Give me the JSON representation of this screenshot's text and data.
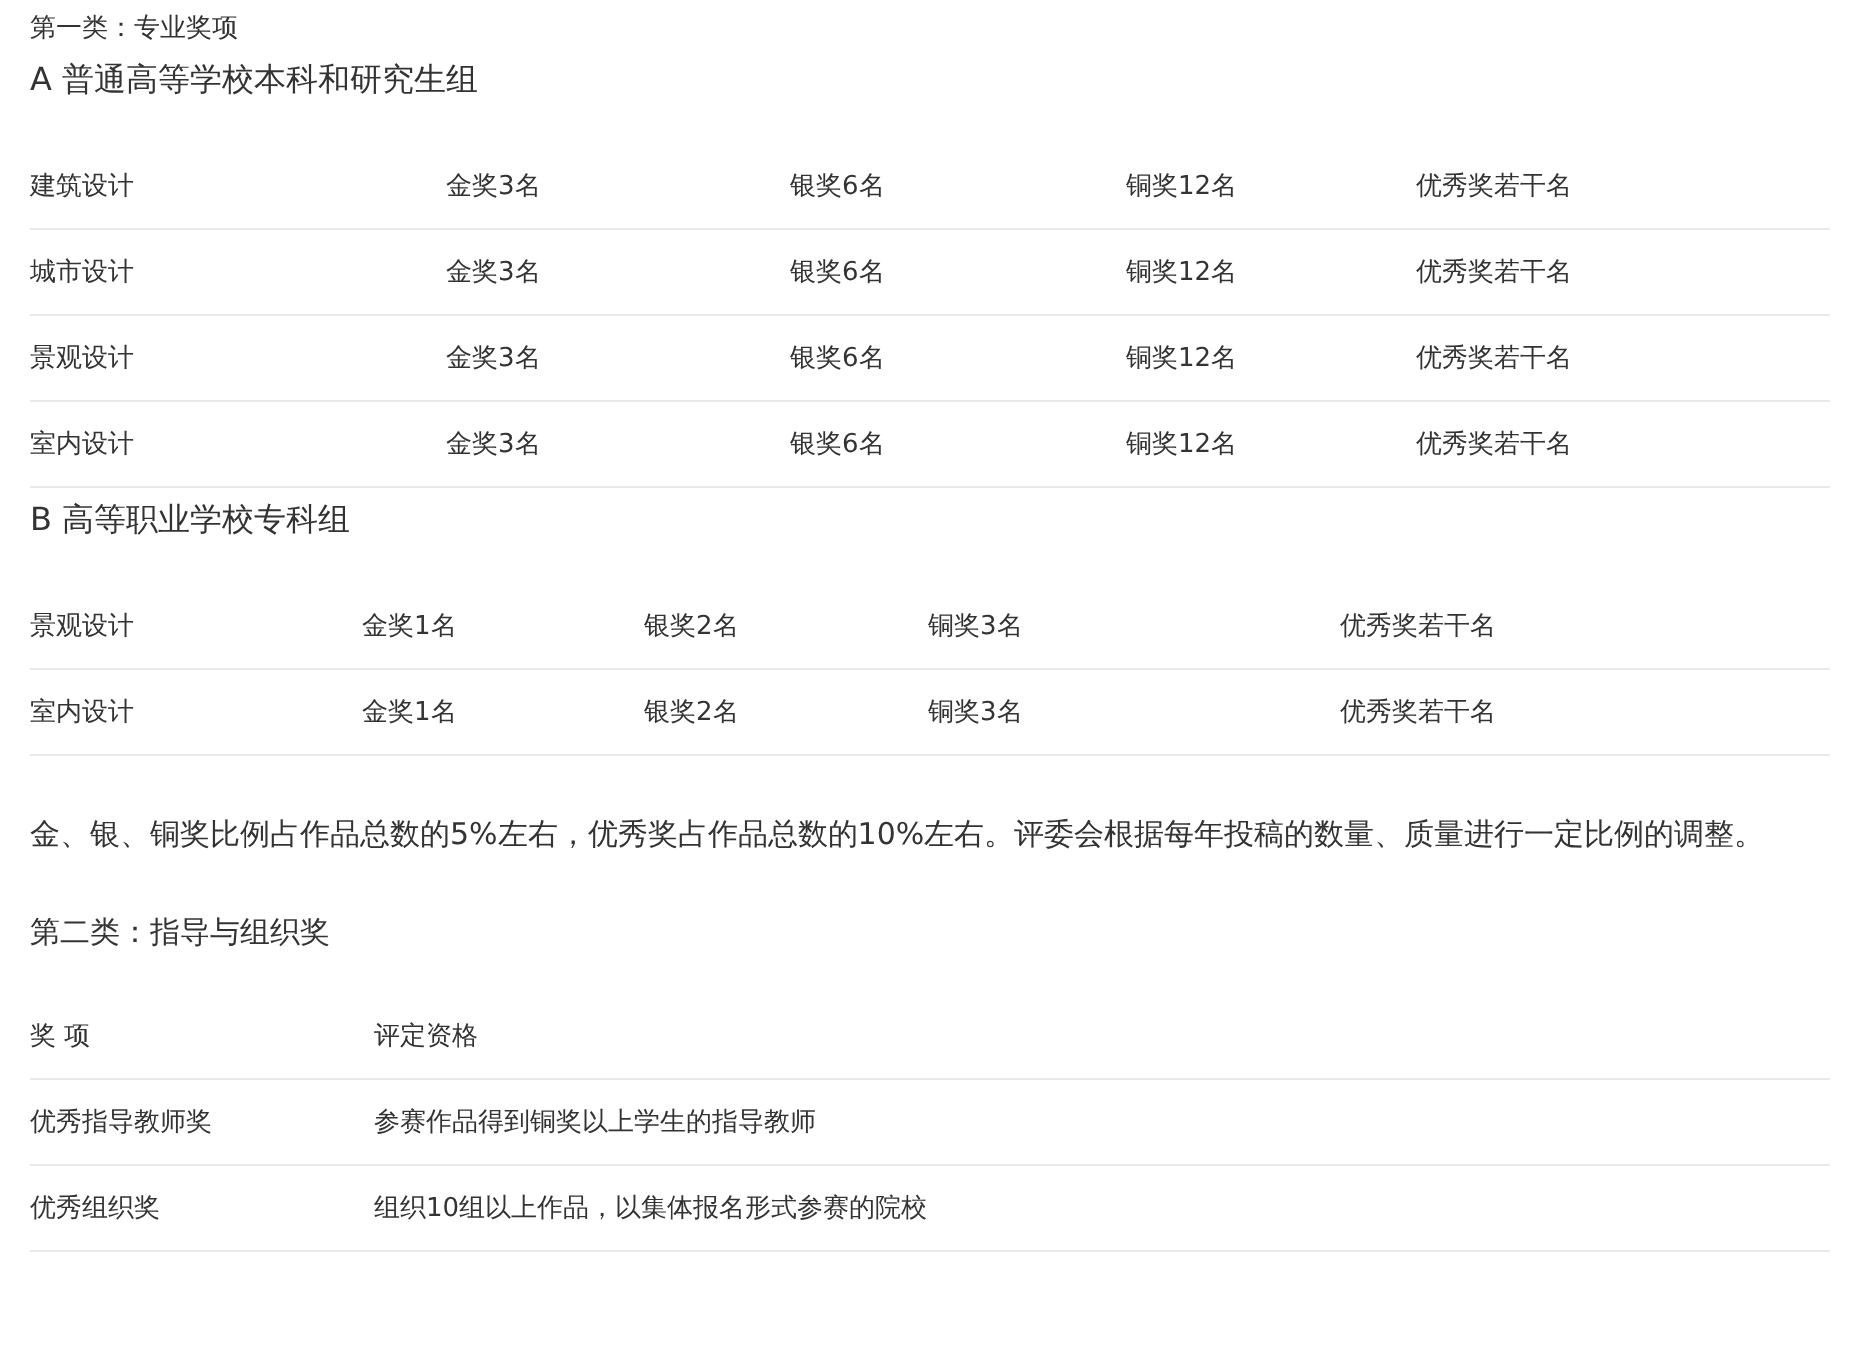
{
  "blocks": [
    {
      "kind": "heading",
      "text": "第一类：专业奖项"
    },
    {
      "kind": "subheading",
      "text": "A 普通高等学校本科和研究生组"
    },
    {
      "kind": "table",
      "rows": [
        [
          "建筑设计",
          "金奖3名",
          "银奖6名",
          "铜奖12名",
          "优秀奖若干名"
        ],
        [
          "城市设计",
          "金奖3名",
          "银奖6名",
          "铜奖12名",
          "优秀奖若干名"
        ],
        [
          "景观设计",
          "金奖3名",
          "银奖6名",
          "铜奖12名",
          "优秀奖若干名"
        ],
        [
          "室内设计",
          "金奖3名",
          "银奖6名",
          "铜奖12名",
          "优秀奖若干名"
        ]
      ]
    },
    {
      "kind": "subheading",
      "text": "B 高等职业学校专科组"
    },
    {
      "kind": "table",
      "rows": [
        [
          "景观设计",
          "金奖1名",
          "银奖2名",
          "铜奖3名",
          "优秀奖若干名"
        ],
        [
          "室内设计",
          "金奖1名",
          "银奖2名",
          "铜奖3名",
          "优秀奖若干名"
        ]
      ]
    },
    {
      "kind": "paragraph",
      "text": "金、银、铜奖比例占作品总数的5%左右，优秀奖占作品总数的10%左右。评委会根据每年投稿的数量、质量进行一定比例的调整。"
    },
    {
      "kind": "heading2",
      "text": "第二类：指导与组织奖"
    },
    {
      "kind": "table",
      "columns": [
        "奖 项",
        "评定资格"
      ],
      "rows": [
        [
          "优秀指导教师奖",
          "参赛作品得到铜奖以上学生的指导教师"
        ],
        [
          "优秀组织奖",
          "组织10组以上作品，以集体报名形式参赛的院校"
        ]
      ]
    }
  ]
}
